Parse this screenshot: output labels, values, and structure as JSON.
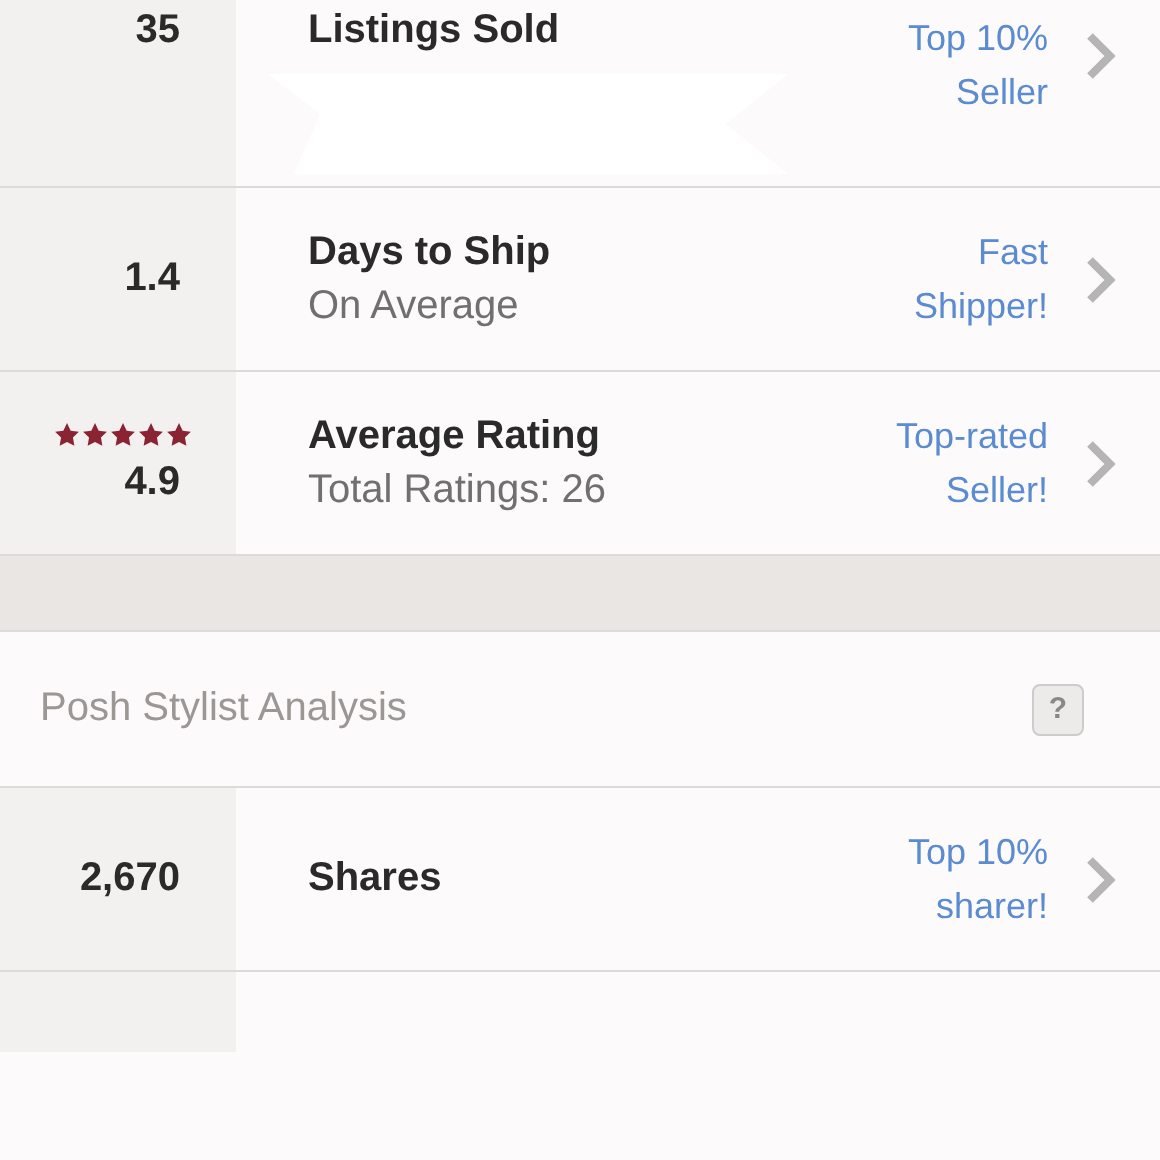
{
  "seller_stats": [
    {
      "value": "35",
      "title": "Listings Sold",
      "badge": "Top 10% Seller",
      "covered": true
    },
    {
      "value": "1.4",
      "title": "Days to Ship",
      "subtitle": "On Average",
      "badge": "Fast Shipper!"
    },
    {
      "value": "4.9",
      "stars": 5,
      "title": "Average Rating",
      "subtitle": "Total Ratings: 26",
      "badge": "Top-rated Seller!"
    }
  ],
  "posh_stylist_analysis": {
    "title": "Posh Stylist Analysis",
    "help": "?",
    "rows": [
      {
        "value": "2,670",
        "title": "Shares",
        "badge": "Top 10% sharer!"
      }
    ]
  }
}
